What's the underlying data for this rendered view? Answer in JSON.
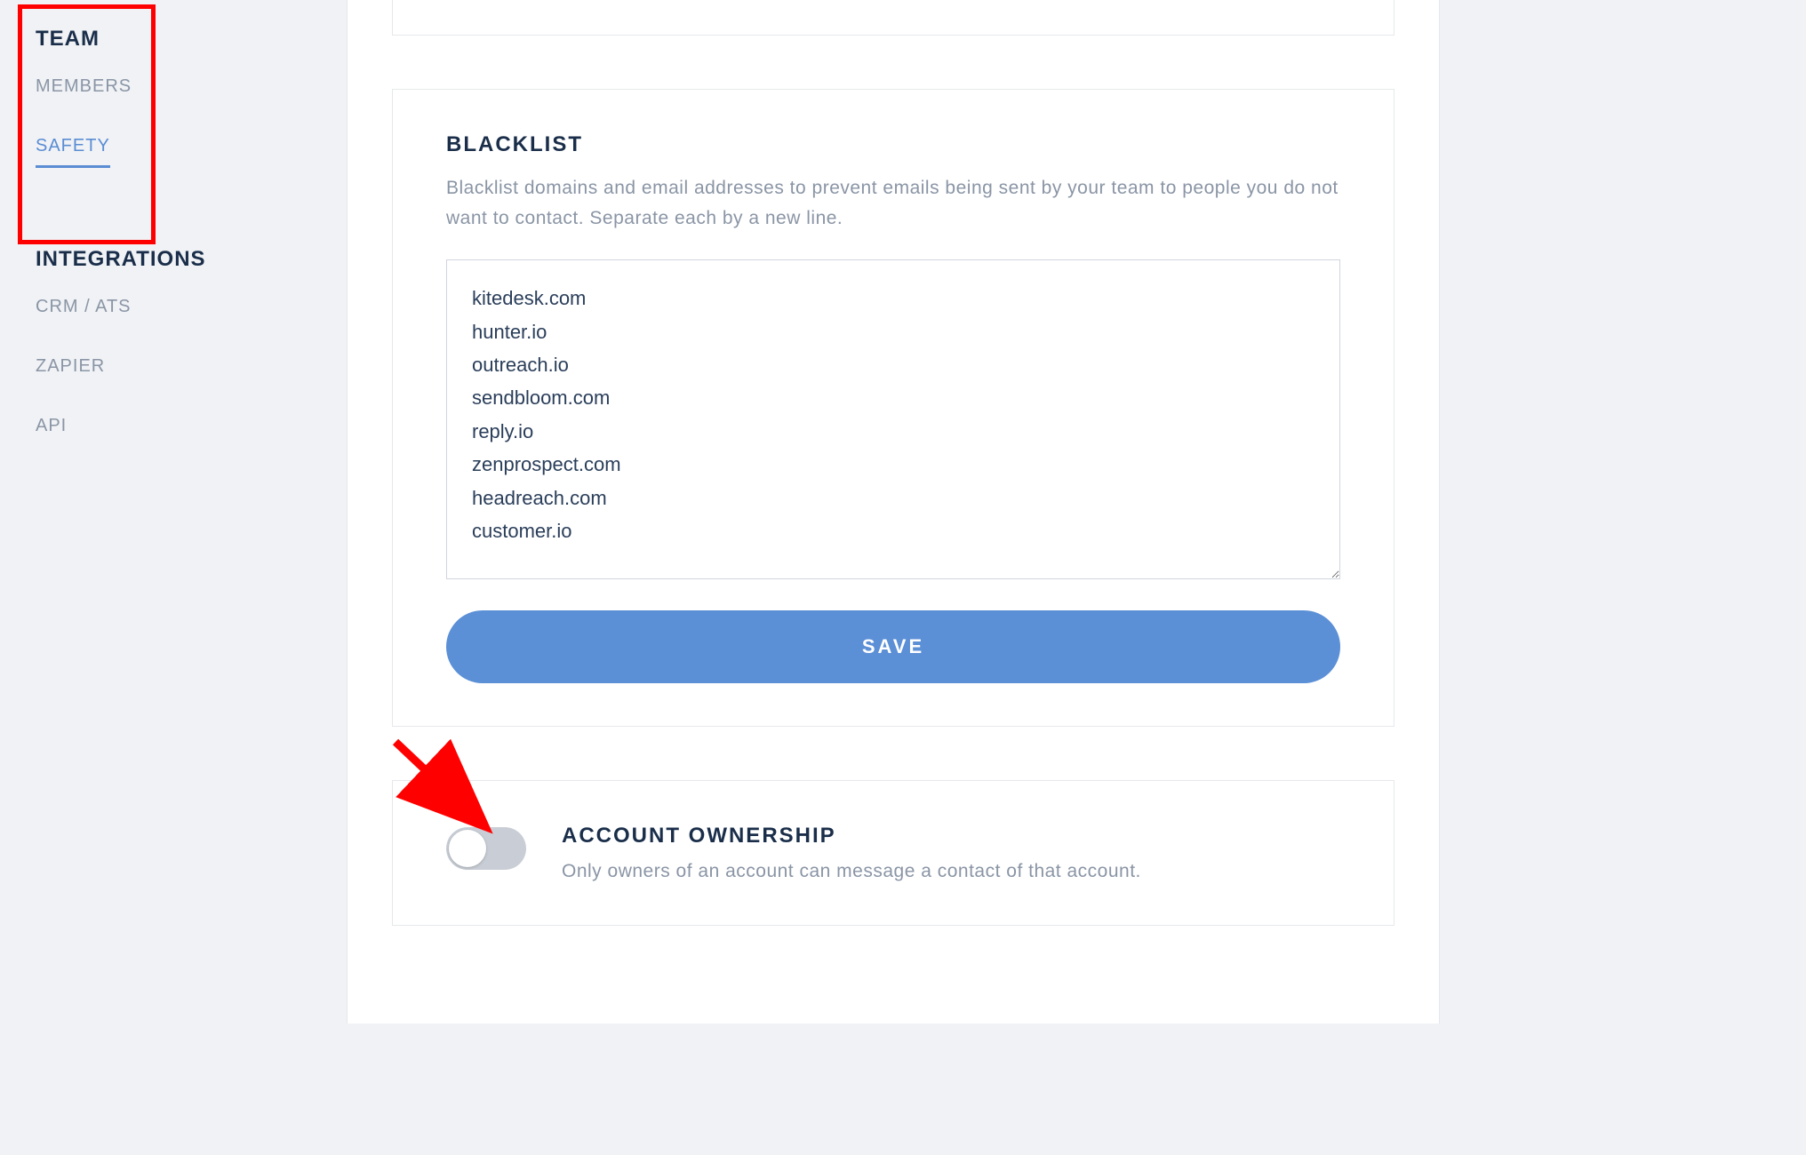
{
  "sidebar": {
    "sections": [
      {
        "heading": "TEAM",
        "items": [
          {
            "label": "MEMBERS",
            "active": false
          },
          {
            "label": "SAFETY",
            "active": true
          }
        ]
      },
      {
        "heading": "INTEGRATIONS",
        "items": [
          {
            "label": "CRM / ATS",
            "active": false
          },
          {
            "label": "ZAPIER",
            "active": false
          },
          {
            "label": "API",
            "active": false
          }
        ]
      }
    ]
  },
  "blacklist": {
    "title": "BLACKLIST",
    "description": "Blacklist domains and email addresses to prevent emails being sent by your team to people you do not want to contact. Separate each by a new line.",
    "value": "kitedesk.com\nhunter.io\noutreach.io\nsendbloom.com\nreply.io\nzenprospect.com\nheadreach.com\ncustomer.io",
    "save_label": "SAVE"
  },
  "ownership": {
    "title": "ACCOUNT OWNERSHIP",
    "description": "Only owners of an account can message a contact of that account.",
    "enabled": false
  }
}
